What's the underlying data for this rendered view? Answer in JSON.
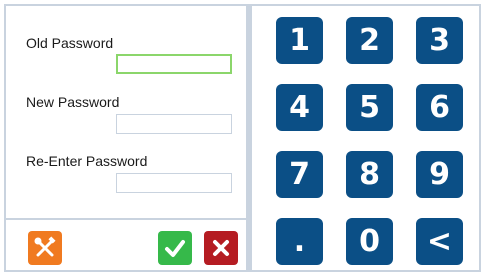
{
  "form": {
    "old_password_label": "Old Password",
    "old_password_value": "",
    "new_password_label": "New Password",
    "new_password_value": "",
    "reenter_password_label": "Re-Enter Password",
    "reenter_password_value": ""
  },
  "actions": {
    "tools_icon": "tools-icon",
    "confirm_icon": "checkmark-icon",
    "cancel_icon": "close-icon"
  },
  "keypad": {
    "keys": [
      "1",
      "2",
      "3",
      "4",
      "5",
      "6",
      "7",
      "8",
      "9",
      ".",
      "0",
      "<"
    ]
  },
  "colors": {
    "key_background": "#0b4f86",
    "tools_button": "#f07a20",
    "confirm_button": "#36b94a",
    "cancel_button": "#b51c22",
    "focus_border": "#8bd66b",
    "panel_border": "#c9d3df"
  }
}
